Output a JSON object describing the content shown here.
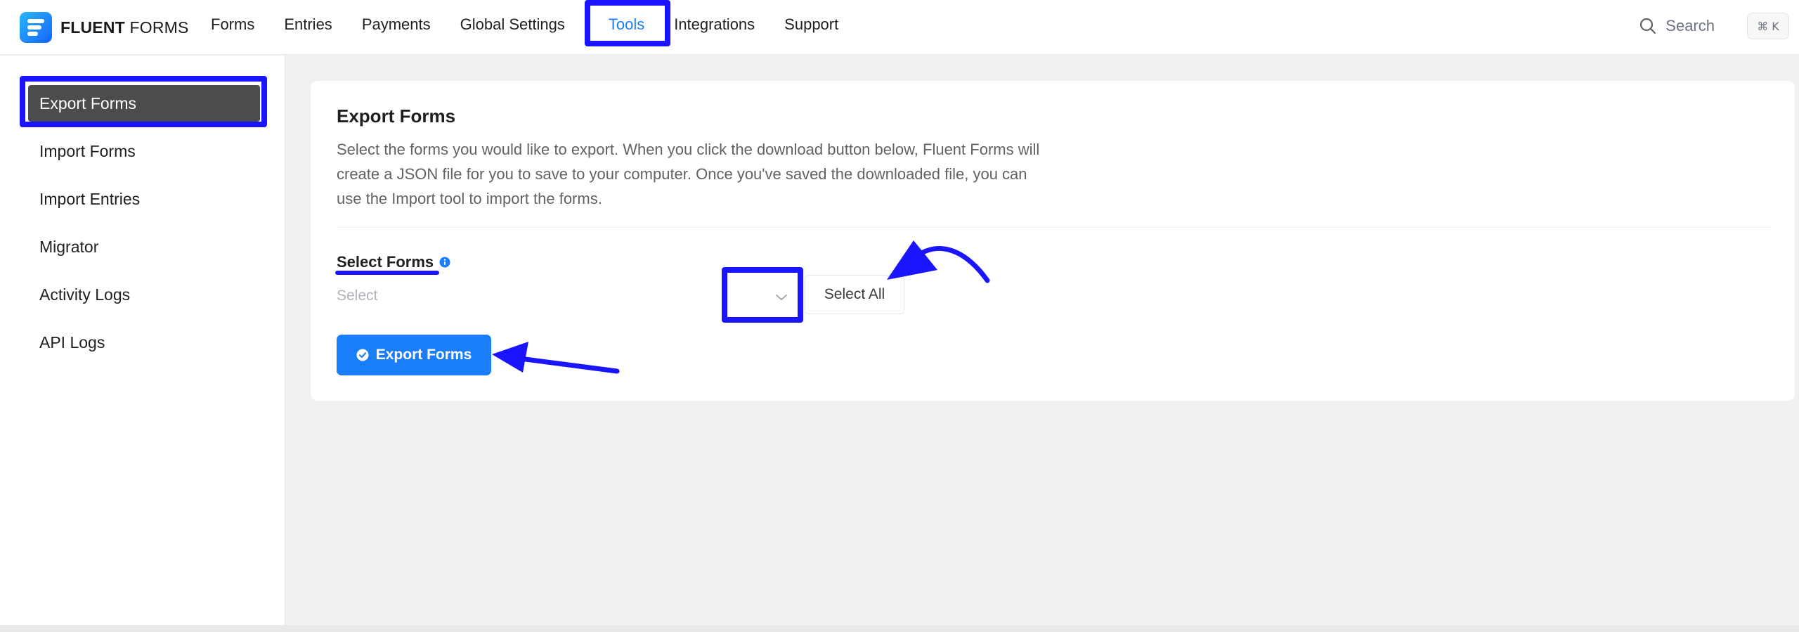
{
  "app": {
    "logo_bold": "FLUENT",
    "logo_light": "FORMS",
    "brand_color": "#1a7efb"
  },
  "nav": {
    "items": [
      {
        "label": "Forms"
      },
      {
        "label": "Entries"
      },
      {
        "label": "Payments"
      },
      {
        "label": "Global Settings"
      },
      {
        "label": "Tools",
        "active": true
      },
      {
        "label": "Integrations"
      },
      {
        "label": "Support"
      }
    ]
  },
  "search": {
    "label": "Search",
    "shortcut": "⌘ K",
    "icon": "search-icon"
  },
  "sidebar": {
    "items": [
      {
        "label": "Export Forms",
        "active": true
      },
      {
        "label": "Import Forms"
      },
      {
        "label": "Import Entries"
      },
      {
        "label": "Migrator"
      },
      {
        "label": "Activity Logs"
      },
      {
        "label": "API Logs"
      }
    ]
  },
  "main": {
    "title": "Export Forms",
    "description": "Select the forms you would like to export. When you click the download button below, Fluent Forms will create a JSON file for you to save to your computer. Once you've saved the downloaded file, you can use the Import tool to import the forms.",
    "select_label": "Select Forms",
    "select_placeholder": "Select",
    "select_all_label": "Select All",
    "export_button_label": "Export Forms"
  },
  "colors": {
    "annotation": "#1a14ff",
    "sidebar_active_bg": "#4b4c4d",
    "page_bg": "#f1f1f1"
  }
}
